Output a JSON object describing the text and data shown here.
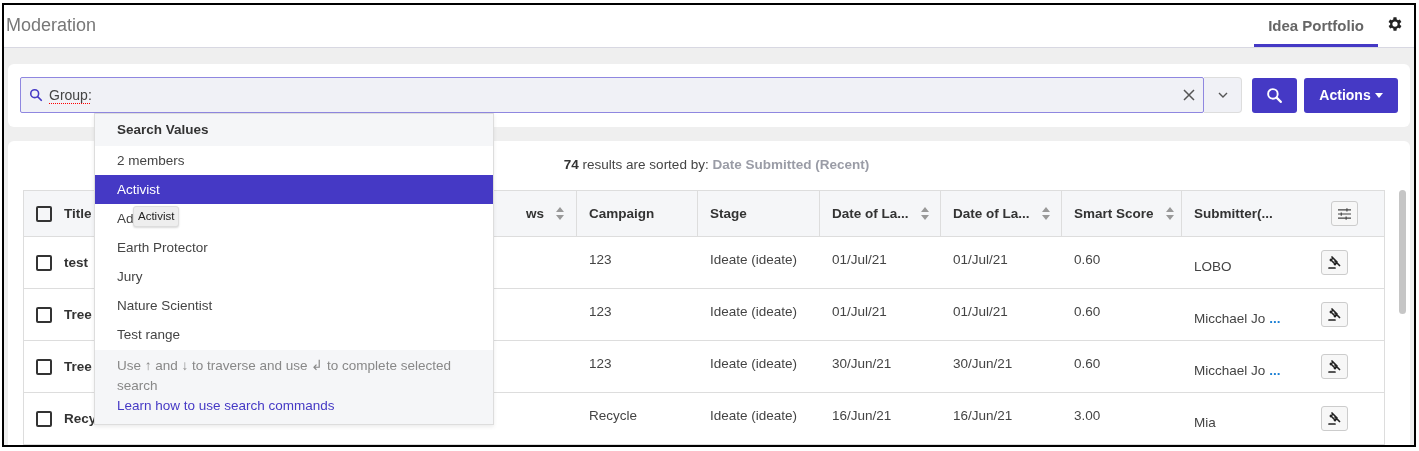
{
  "header": {
    "title": "Moderation",
    "tabs": [
      {
        "label": "Idea Portfolio",
        "selected": true
      }
    ]
  },
  "search": {
    "value": "Group:",
    "actions_label": "Actions"
  },
  "dropdown": {
    "heading": "Search Values",
    "items": [
      {
        "label": "2 members",
        "selected": false
      },
      {
        "label": "Activist",
        "selected": true
      },
      {
        "label": "Ad",
        "selected": false,
        "tooltip": "Activist"
      },
      {
        "label": "Earth Protector",
        "selected": false
      },
      {
        "label": "Jury",
        "selected": false
      },
      {
        "label": "Nature Scientist",
        "selected": false
      },
      {
        "label": "Test range",
        "selected": false
      }
    ],
    "hint": "Use ↑ and ↓ to traverse and use ↲ to complete selected search",
    "link": "Learn how to use search commands"
  },
  "results": {
    "count": "74",
    "text": "results are sorted by:",
    "sort": "Date Submitted (Recent)"
  },
  "table": {
    "select_all_checked": false,
    "columns": [
      {
        "label": "Title"
      },
      {
        "label": "ws",
        "sortable": true
      },
      {
        "label": "Campaign",
        "sortable": false
      },
      {
        "label": "Stage",
        "sortable": false
      },
      {
        "label": "Date of La...",
        "sortable": true
      },
      {
        "label": "Date of La...",
        "sortable": true
      },
      {
        "label": "Smart Score",
        "sortable": true
      },
      {
        "label": "Submitter(...",
        "sortable": false
      }
    ],
    "rows": [
      {
        "checked": false,
        "title": "test",
        "campaign": "123",
        "stage": "Ideate (ideate)",
        "date_1": "01/Jul/21",
        "date_2": "01/Jul/21",
        "smart_score": "0.60",
        "submitter": "LOBO"
      },
      {
        "checked": false,
        "title": "Tree",
        "campaign": "123",
        "stage": "Ideate (ideate)",
        "date_1": "01/Jul/21",
        "date_2": "01/Jul/21",
        "smart_score": "0.60",
        "submitter": "Micchael Jo",
        "more": "..."
      },
      {
        "checked": false,
        "title": "Tree",
        "campaign": "123",
        "stage": "Ideate (ideate)",
        "date_1": "30/Jun/21",
        "date_2": "30/Jun/21",
        "smart_score": "0.60",
        "submitter": "Micchael Jo",
        "more": "..."
      },
      {
        "checked": false,
        "title": "Recy",
        "campaign": "Recycle",
        "stage": "Ideate (ideate)",
        "date_1": "16/Jun/21",
        "date_2": "16/Jun/21",
        "smart_score": "3.00",
        "submitter": "Mia"
      }
    ]
  }
}
